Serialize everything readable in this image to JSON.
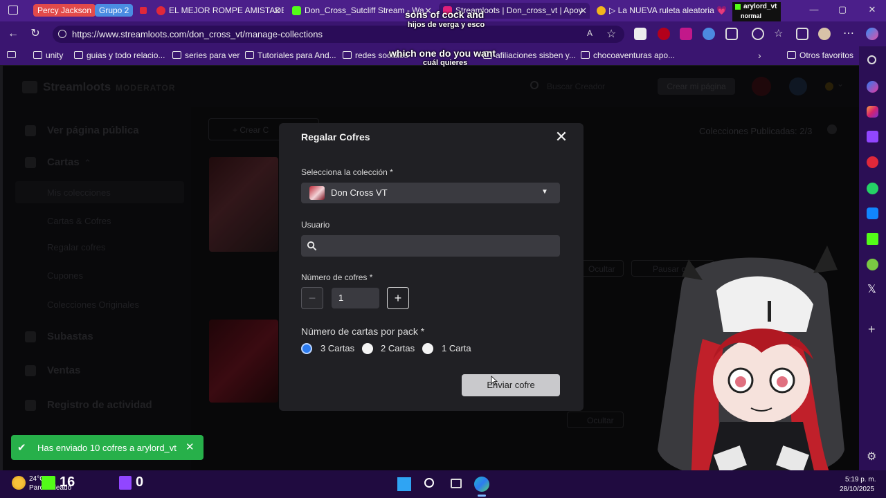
{
  "browser": {
    "tab_groups": [
      {
        "label": "Percy Jackson",
        "color": "#e24a4a"
      },
      {
        "label": "Grupo 2",
        "color": "#4a8ce2"
      }
    ],
    "tabs": [
      {
        "label": "EL MEJOR ROMPE AMISTADE",
        "favicon_color": "#e0283a"
      },
      {
        "label": "Don_Cross_Sutcliff Stream - Wa",
        "favicon_color": "#53fc18"
      },
      {
        "label": "Streamloots | Don_cross_vt | Apoy",
        "favicon_color": "#e2207a"
      },
      {
        "label": "▷ La NUEVA ruleta aleatoria 💗",
        "favicon_color": "#f2b51c"
      }
    ],
    "url": "https://www.streamloots.com/don_cross_vt/manage-collections",
    "bookmarks": [
      "unity",
      "guias y todo relacio...",
      "series para ver",
      "Tutoriales para And...",
      "redes sociales",
      "afiliaciones sisben y...",
      "chocoaventuras apo..."
    ],
    "bookmarks_other": "Otros favoritos"
  },
  "streamloots": {
    "brand": "Streamloots",
    "role": "MODERATOR",
    "search_placeholder": "Buscar Creador",
    "create_page": "Crear mi página",
    "published_collections": "Colecciones Publicadas: 2/3",
    "create_button": "+ Crear C",
    "nav": {
      "public_page": "Ver página pública",
      "cards": "Cartas",
      "my_collections": "Mis colecciones",
      "cards_chests": "Cartas & Cofres",
      "gift_chests": "Regalar cofres",
      "coupons": "Cupones",
      "originals": "Colecciones Originales",
      "auctions": "Subastas",
      "sales": "Ventas",
      "activity": "Registro de actividad"
    },
    "card_actions": {
      "hide": "Ocultar",
      "pause": "Pausar cartas"
    }
  },
  "modal": {
    "title": "Regalar Cofres",
    "collection_label": "Selecciona la colección *",
    "collection_value": "Don Cross VT",
    "user_label": "Usuario",
    "user_value": "",
    "chests_label": "Número de cofres *",
    "chests_value": "1",
    "cards_per_pack_label": "Número de cartas por pack *",
    "options": [
      "3 Cartas",
      "2 Cartas",
      "1 Carta"
    ],
    "selected_option": "3 Cartas",
    "send_button": "Enviar cofre"
  },
  "toast": {
    "message": "Has enviado 10 cofres a arylord_vt"
  },
  "captions": {
    "line1_en": "sons of cock and",
    "line1_es": "hijos de verga y esco",
    "line2_en": "which one do you want",
    "line2_es": "cuál quieres"
  },
  "stream_overlay": {
    "username": "arylord_vt",
    "status": "normal"
  },
  "taskbar": {
    "weather_temp": "24°C",
    "weather_desc": "Parc. soleado",
    "kick_count": "16",
    "twitch_count": "0",
    "time": "5:19 p. m.",
    "date": "28/10/2025"
  }
}
